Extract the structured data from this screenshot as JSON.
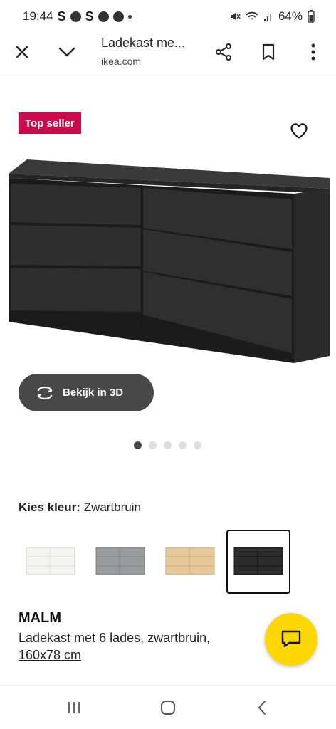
{
  "status_bar": {
    "time": "19:44",
    "left_letters": [
      "S",
      "S"
    ],
    "battery": "64%"
  },
  "browser": {
    "title": "Ladekast me...",
    "domain": "ikea.com"
  },
  "product": {
    "badge": "Top seller",
    "view_3d_label": "Bekijk in 3D",
    "carousel": {
      "count": 5,
      "active_index": 0
    },
    "color_label": "Kies kleur:",
    "color_value": "Zwartbruin",
    "swatches": [
      {
        "name": "wit",
        "color": "#f4f4f2",
        "selected": false
      },
      {
        "name": "grijs",
        "color": "#9a9b9c",
        "selected": false
      },
      {
        "name": "eikenfineer",
        "color": "#e6c99a",
        "selected": false
      },
      {
        "name": "zwartbruin",
        "color": "#2c2c2c",
        "selected": true
      }
    ],
    "name": "MALM",
    "description": "Ladekast met 6 lades, zwartbruin,",
    "dimensions": "160x78 cm"
  },
  "colors": {
    "badge_red": "#cc0a4b",
    "button_dark": "#484848",
    "chat_yellow": "#ffd600"
  }
}
